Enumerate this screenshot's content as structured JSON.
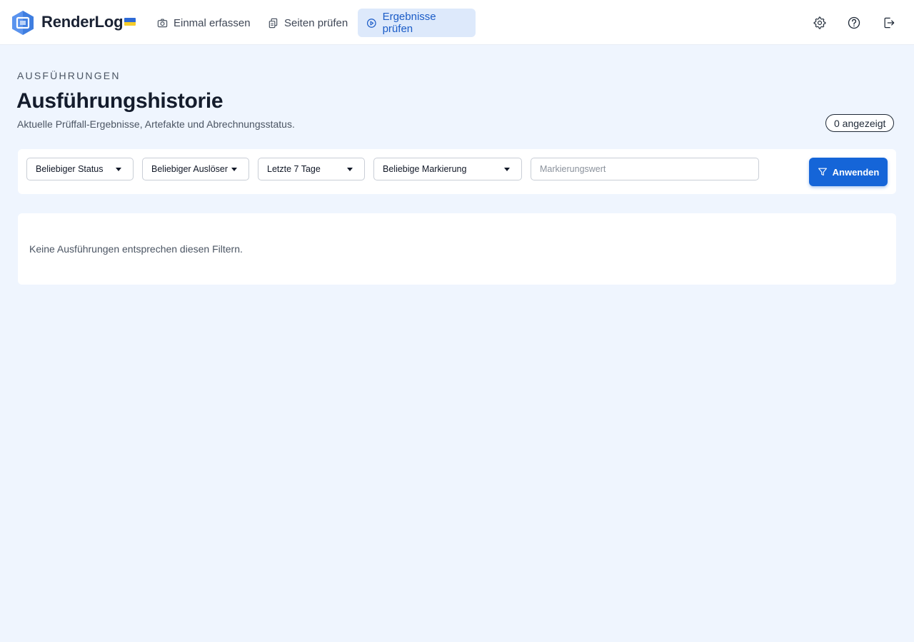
{
  "app": {
    "brand": "RenderLog",
    "flag_colors": [
      "#2e6ad6",
      "#f5cc2b"
    ]
  },
  "nav": {
    "items": [
      {
        "label": "Einmal erfassen",
        "icon": "camera-icon",
        "active": false
      },
      {
        "label": "Seiten prüfen",
        "icon": "pages-icon",
        "active": false
      },
      {
        "label": "Ergebnisse prüfen",
        "icon": "play-circle-icon",
        "active": true
      }
    ],
    "actions": [
      "gear-icon",
      "help-icon",
      "logout-icon"
    ]
  },
  "header": {
    "eyebrow": "AUSFÜHRUNGEN",
    "title": "Ausführungshistorie",
    "subtitle": "Aktuelle Prüffall-Ergebnisse, Artefakte und Abrechnungsstatus.",
    "count_badge": "0 angezeigt"
  },
  "filters": {
    "status": "Beliebiger Status",
    "trigger": "Beliebiger Auslöser",
    "period": "Letzte 7 Tage",
    "tag": "Beliebige Markierung",
    "tag_value_placeholder": "Markierungswert",
    "tag_value": "",
    "apply_label": "Anwenden"
  },
  "results": {
    "empty_message": "Keine Ausführungen entsprechen diesen Filtern."
  },
  "colors": {
    "accent": "#1565d8",
    "nav_active_bg": "#dde9fb",
    "page_bg": "#eff5fe"
  }
}
